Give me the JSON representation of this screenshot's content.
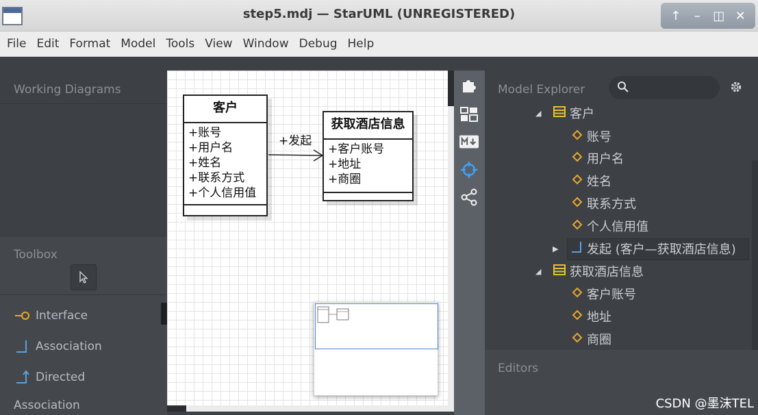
{
  "window": {
    "title": "step5.mdj — StarUML (UNREGISTERED)",
    "controls": [
      "↑",
      "–",
      "◫",
      "✕"
    ]
  },
  "menu": [
    "File",
    "Edit",
    "Format",
    "Model",
    "Tools",
    "View",
    "Window",
    "Debug",
    "Help"
  ],
  "working_diagrams": {
    "header": "Working Diagrams"
  },
  "toolbox": {
    "header": "Toolbox",
    "items": [
      "Interface",
      "Association",
      "Directed",
      "Association"
    ]
  },
  "diagram": {
    "class_customer": {
      "name": "客户",
      "attributes": [
        "+账号",
        "+用户名",
        "+姓名",
        "+联系方式",
        "+个人信用值"
      ]
    },
    "class_hotel": {
      "name": "获取酒店信息",
      "attributes": [
        "+客户账号",
        "+地址",
        "+商圈"
      ]
    },
    "association_label": "+发起"
  },
  "model_explorer": {
    "header": "Model Explorer",
    "search_placeholder": "",
    "tree": [
      {
        "level": 0,
        "toggle": "◢",
        "icon": "class-icon",
        "label": "客户"
      },
      {
        "level": 1,
        "toggle": "",
        "icon": "attribute-icon",
        "label": "账号"
      },
      {
        "level": 1,
        "toggle": "",
        "icon": "attribute-icon",
        "label": "用户名"
      },
      {
        "level": 1,
        "toggle": "",
        "icon": "attribute-icon",
        "label": "姓名"
      },
      {
        "level": 1,
        "toggle": "",
        "icon": "attribute-icon",
        "label": "联系方式"
      },
      {
        "level": 1,
        "toggle": "",
        "icon": "attribute-icon",
        "label": "个人信用值"
      },
      {
        "level": 1,
        "toggle": "▶",
        "icon": "association-icon",
        "label": "发起 (客户—获取酒店信息)"
      },
      {
        "level": 0,
        "toggle": "◢",
        "icon": "class-icon",
        "label": "获取酒店信息"
      },
      {
        "level": 1,
        "toggle": "",
        "icon": "attribute-icon",
        "label": "客户账号"
      },
      {
        "level": 1,
        "toggle": "",
        "icon": "attribute-icon",
        "label": "地址"
      },
      {
        "level": 1,
        "toggle": "",
        "icon": "attribute-icon",
        "label": "商圈"
      }
    ]
  },
  "editors": {
    "header": "Editors"
  },
  "watermark": "CSDN @墨沫TEL",
  "colors": {
    "panel_bg": "#3d4146",
    "attribute_icon": "#e8a82c",
    "class_icon": "#e8c22c",
    "association_icon": "#5aa0e0",
    "tool_icon": "#e8a82c"
  }
}
